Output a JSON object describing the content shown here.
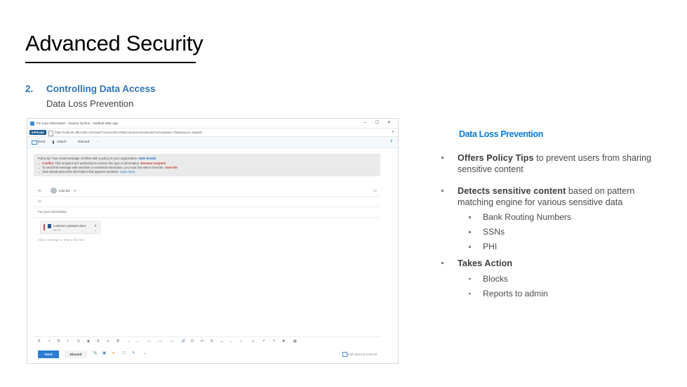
{
  "slide": {
    "title": "Advanced Security",
    "agenda_number": "2.",
    "agenda_label": "Controlling Data Access",
    "agenda_sub": "Data Loss Prevention",
    "title_color": "#000000",
    "accent_color": "#2e74b5"
  },
  "content": {
    "heading": "Data Loss Prevention",
    "heading_color": "#0b7bd5",
    "bullets": [
      {
        "bold": "Offers Policy Tips",
        "rest": " to prevent users from sharing sensitive content"
      },
      {
        "bold": "Detects sensitive content",
        "rest": " based on pattern matching engine for various sensitive data",
        "sub": [
          "Bank Routing Numbers",
          "SSNs",
          "PHI"
        ]
      },
      {
        "bold": "Takes Action",
        "rest": "",
        "sub": [
          "Blocks",
          "Reports to admin"
        ]
      }
    ]
  },
  "browser": {
    "tab_title": "For your information - Jeanne Tychon - Outlook Web App",
    "favicon": "outlook-favicon-icon",
    "window_controls": {
      "minimize": "–",
      "maximize": "☐",
      "close": "✕"
    },
    "address_bar": {
      "inprivate_badge": "InPrivate",
      "lock_icon": "lock-icon",
      "url": "https://outlook.office365.com/owa/?viewmodel=IMailComposeViewModelFactory&wid=73&ispopout=1&path=",
      "favorite_icon": "star-icon"
    },
    "command_bar": {
      "send": "Send",
      "attach": "Attach",
      "discard": "Discard",
      "more": "···",
      "right_icon": "help-icon"
    },
    "policy_tip": {
      "headline": "Policy tip: Your email message conflicts with a policy in your organization.",
      "headline_link": "Hide details",
      "items": [
        {
          "lead": "Conflict.",
          "text": " This recipient isn't authorized to receive this type of information.",
          "link": "Remove recipient"
        },
        {
          "lead": "",
          "text": "To send this message with sensitive or restricted information, you must first select Override.",
          "link": "Override"
        },
        {
          "lead": "",
          "text": "View details about this information that appears sensitive.",
          "link": "Learn more"
        }
      ]
    },
    "compose": {
      "to_label": "To",
      "to_recipient": "Lisa Du",
      "to_remove_icon": "close-icon",
      "cc_toggle": "Cc",
      "cc_label": "Cc",
      "subject": "For your information",
      "attachment": {
        "name": "customer passport.docx",
        "size": "58 KB",
        "remove_icon": "close-icon",
        "menu_icon": "chevron-down-icon"
      },
      "body_placeholder": "Add a message or drag a file here"
    },
    "format_toolbar_icons": [
      "font-color-icon",
      "font-size-icon",
      "bold-icon",
      "italic-icon",
      "underline-icon",
      "highlight-icon",
      "text-color-icon",
      "bullet-list-icon",
      "numbered-list-icon",
      "indent-icon",
      "outdent-icon",
      "align-left-icon",
      "align-center-icon",
      "align-right-icon",
      "link-icon",
      "unlink-icon",
      "superscript-icon",
      "subscript-icon",
      "strikethrough-icon",
      "quote-icon",
      "code-icon",
      "emoji-icon",
      "undo-icon",
      "redo-icon",
      "clear-format-icon",
      "table-icon"
    ],
    "bottom_bar": {
      "send": "Send",
      "discard": "Discard",
      "icons": [
        "attach-icon",
        "picture-icon",
        "emoji-icon",
        "signature-icon",
        "ink-icon",
        "chevron-down-icon"
      ],
      "draft_status": "Draft saved at 9:49 AM",
      "draft_icon": "draft-icon"
    }
  }
}
